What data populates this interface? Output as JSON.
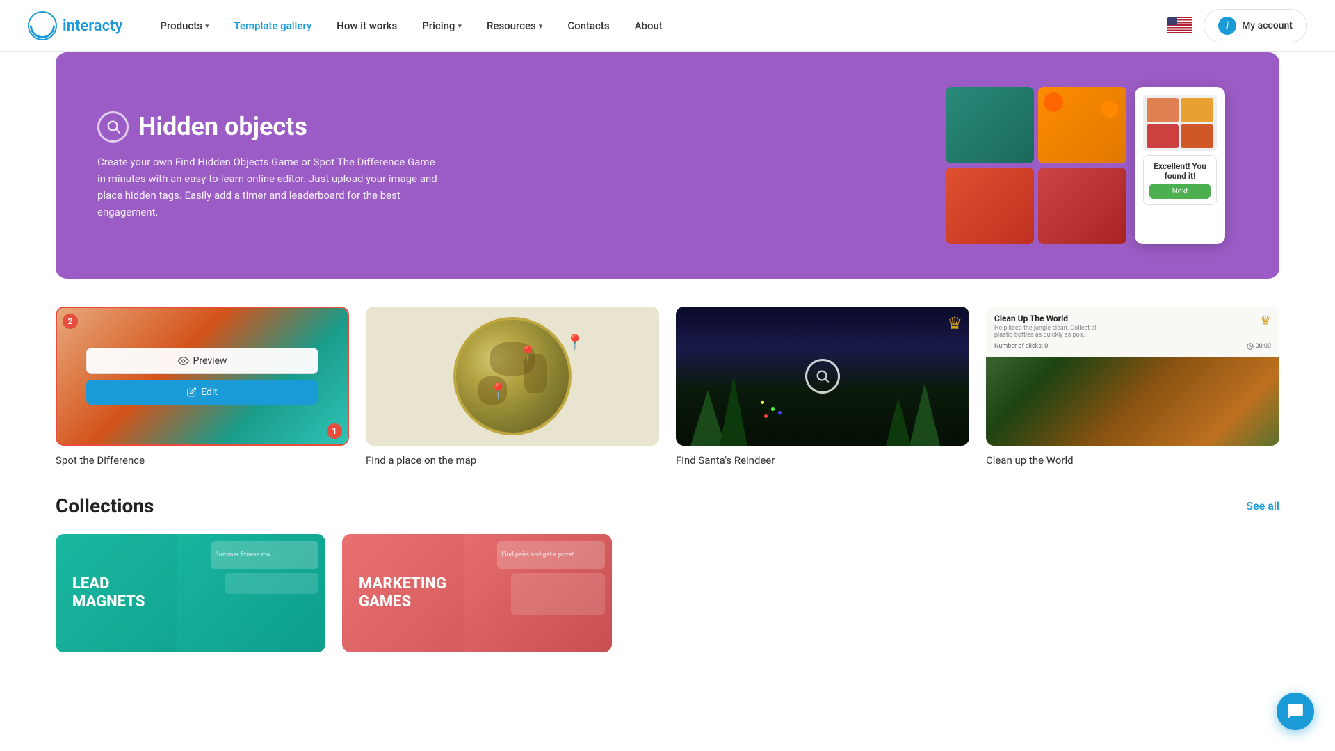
{
  "navbar": {
    "logo_text": "interacty",
    "nav_items": [
      {
        "label": "Products",
        "has_dropdown": true,
        "active": false
      },
      {
        "label": "Template gallery",
        "has_dropdown": false,
        "active": true
      },
      {
        "label": "How it works",
        "has_dropdown": false,
        "active": false
      },
      {
        "label": "Pricing",
        "has_dropdown": true,
        "active": false
      },
      {
        "label": "Resources",
        "has_dropdown": true,
        "active": false
      },
      {
        "label": "Contacts",
        "has_dropdown": false,
        "active": false
      },
      {
        "label": "About",
        "has_dropdown": false,
        "active": false
      }
    ],
    "my_account_label": "My account",
    "account_icon": "i"
  },
  "hero": {
    "title": "Hidden objects",
    "description": "Create your own Find Hidden Objects Game or Spot The Difference Game in minutes with an easy-to-learn online editor. Just upload your image and place hidden tags. Easily add a timer and leaderboard for the best engagement.",
    "found_title": "Excellent! You found it!",
    "next_btn": "Next"
  },
  "cards": [
    {
      "label": "Spot the Difference",
      "badge_top": "2",
      "badge_bottom": "1",
      "preview_label": "Preview",
      "edit_label": "Edit"
    },
    {
      "label": "Find a place on the map"
    },
    {
      "label": "Find Santa's Reindeer"
    },
    {
      "label": "Clean up the World",
      "world_title": "Clean Up The World",
      "world_sub": "Help keep the jungle clean. Collect all plastic bottles as quickly as pos...",
      "world_clicks": "Number of clicks: 0",
      "world_time": "00:00"
    }
  ],
  "collections": {
    "title": "Collections",
    "see_all": "See all",
    "items": [
      {
        "label": "LEAD\nMAGNETS",
        "deco_text": "Summer fitness ma..."
      },
      {
        "label": "MARKETING\nGAMES",
        "deco_text": "Find pairs and get a prize!"
      }
    ]
  }
}
